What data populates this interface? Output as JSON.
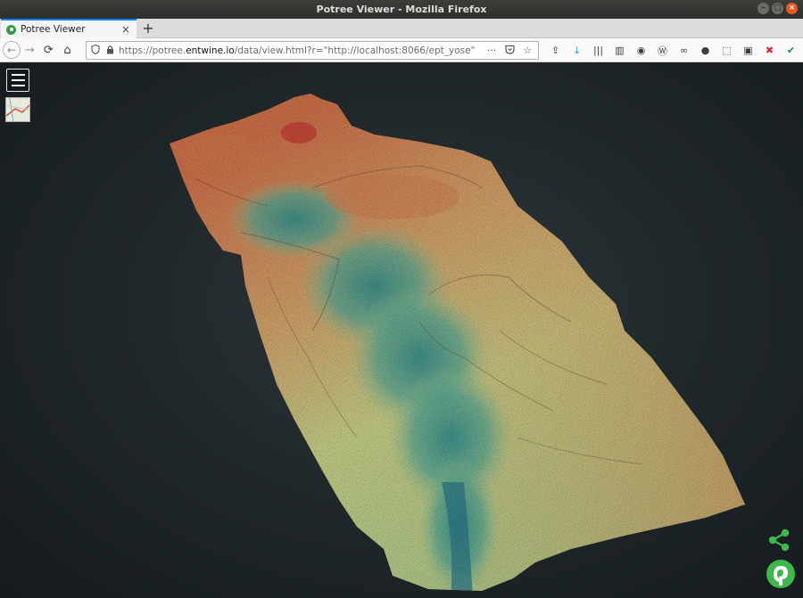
{
  "window": {
    "title": "Potree Viewer - Mozilla Firefox",
    "controls": [
      "minimize",
      "maximize",
      "close"
    ]
  },
  "tabs": [
    {
      "label": "Potree Viewer",
      "favicon": "potree-favicon",
      "close": "×"
    }
  ],
  "new_tab_label": "+",
  "nav": {
    "back": "←",
    "forward": "→",
    "reload": "⟳",
    "home": "⌂"
  },
  "url": {
    "prefix": "https://potree.",
    "host": "entwine.io",
    "path": "/data/view.html?r=\"http://localhost:8066/ept_yose\"",
    "actions": [
      "···",
      "pocket-icon",
      "bookmark-star-icon"
    ]
  },
  "toolbar_icons": [
    "reader-icon",
    "download-icon",
    "library-icon",
    "sidebar-icon",
    "extension-globe-icon",
    "extension-wp-icon",
    "extension-glasses-icon",
    "account-icon",
    "extension-dotted-icon",
    "extension-5e-icon",
    "extension-puzzle-icon",
    "extension-check-icon",
    "hamburger-menu-icon"
  ],
  "viewer": {
    "menu_label": "Toggle sidebar",
    "colors": {
      "low": "#2f8a8e",
      "mid": "#cfe18d",
      "high": "#e07a4f",
      "peak": "#d5473c",
      "accent": "#3cb94a"
    }
  }
}
